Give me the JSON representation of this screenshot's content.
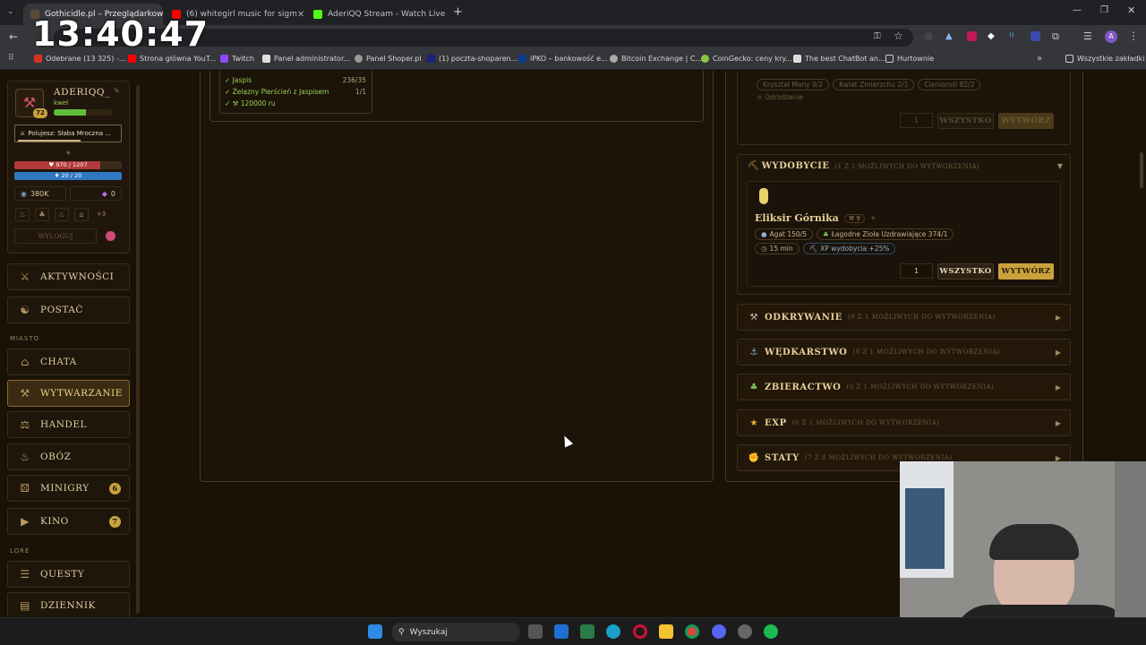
{
  "clock": "13:40:47",
  "browser": {
    "tabs": [
      {
        "title": "Gothicidle.pl – Przeglądarkow",
        "color": "#5a4a3a"
      },
      {
        "title": "(6) whitegirl music for sigm",
        "color": "#ff0000"
      },
      {
        "title": "AderiQQ Stream - Watch Live o",
        "color": "#53fc18"
      }
    ],
    "bookmarks": [
      {
        "label": "Odebrane (13 325) -...",
        "color": "#d93025"
      },
      {
        "label": "Strona główna YouT...",
        "color": "#ff0000"
      },
      {
        "label": "Twitch",
        "color": "#9146ff"
      },
      {
        "label": "Panel administrator...",
        "color": "#e0e0e0"
      },
      {
        "label": "Panel Shoper.pl",
        "color": "#999999"
      },
      {
        "label": "(1) poczta-shoparen...",
        "color": "#1a237e"
      },
      {
        "label": "iPKO – bankowość e...",
        "color": "#0b3d91"
      },
      {
        "label": "Bitcoin Exchange | C...",
        "color": "#aaaaaa"
      },
      {
        "label": "CoinGecko: ceny kry...",
        "color": "#8dc63f"
      },
      {
        "label": "The best ChatBot an...",
        "color": "#dddddd"
      },
      {
        "label": "Hurtownie",
        "color": "#888888"
      }
    ],
    "all_bookmarks": "Wszystkie zakładki"
  },
  "profile": {
    "name": "ADERIQQ_",
    "subtitle": "kwel",
    "level": "72",
    "xp_fraction": 0.55,
    "hunt": "Polujesz: Słaba Mroczna ...",
    "hp": "970 / 1207",
    "hp_fraction": 0.8,
    "mana": "20 / 20",
    "mana_fraction": 1.0,
    "gold": "380K",
    "gems": "0",
    "extra": "+3",
    "logout": "WYLOGUJ"
  },
  "nav": {
    "top": [
      {
        "label": "AKTYWNOŚCI",
        "icon": "crossed-swords-icon"
      },
      {
        "label": "POSTAĆ",
        "icon": "character-icon"
      }
    ],
    "section_city": "MIASTO",
    "city": [
      {
        "label": "CHATA",
        "icon": "hut-icon",
        "badge": ""
      },
      {
        "label": "WYTWARZANIE",
        "icon": "anvil-icon",
        "badge": "",
        "active": true
      },
      {
        "label": "HANDEL",
        "icon": "scales-icon",
        "badge": ""
      },
      {
        "label": "OBÓZ",
        "icon": "campfire-icon",
        "badge": ""
      },
      {
        "label": "MINIGRY",
        "icon": "dice-icon",
        "badge": "6"
      },
      {
        "label": "KINO",
        "icon": "film-icon",
        "badge": "7"
      }
    ],
    "section_lore": "LORE",
    "lore": [
      {
        "label": "QUESTY",
        "icon": "scroll-icon"
      },
      {
        "label": "DZIENNIK",
        "icon": "book-icon"
      }
    ]
  },
  "recipe_top": {
    "rows": [
      {
        "name": "Jaspis",
        "count": "236/35"
      },
      {
        "name": "Żelazny Pierścień z Jaspisem",
        "count": "1/1"
      },
      {
        "name": "120000 ru",
        "count": ""
      }
    ]
  },
  "right_top": {
    "pills": [
      "Kryształ Many 0/2",
      "Kwiat Zmierzchu 2/1",
      "Cieniorośl 82/2"
    ],
    "pill2": "Odrodzenie",
    "qty": "1",
    "all": "WSZYSTKO",
    "make": "WYTWÓRZ"
  },
  "mining": {
    "title": "WYDOBYCIE",
    "subtitle": "(1 Z 1 MOŻLIWYCH DO WYTWORZENIA)",
    "item": {
      "name": "Eliksir Górnika",
      "level": "9",
      "ingredients": [
        "Agat 150/5",
        "Łagodne Zioła Uzdrawiające 374/1"
      ],
      "time": "15 min",
      "bonus": "XP wydobycia +25%",
      "qty": "1",
      "all": "WSZYSTKO",
      "make": "WYTWÓRZ"
    }
  },
  "categories": [
    {
      "name": "ODKRYWANIE",
      "sub": "(0 Z 1 MOŻLIWYCH DO WYTWORZENIA)",
      "icon": "dig-icon",
      "color": "#cfc2a8"
    },
    {
      "name": "WĘDKARSTWO",
      "sub": "(0 Z 1 MOŻLIWYCH DO WYTWORZENIA)",
      "icon": "fishing-icon",
      "color": "#8fb0d0"
    },
    {
      "name": "ZBIERACTWO",
      "sub": "(0 Z 1 MOŻLIWYCH DO WYTWORZENIA)",
      "icon": "herb-icon",
      "color": "#7ec45a"
    },
    {
      "name": "EXP",
      "sub": "(0 Z 1 MOŻLIWYCH DO WYTWORZENIA)",
      "icon": "star-icon",
      "color": "#e8b53a"
    },
    {
      "name": "STATY",
      "sub": "(7 Z 8 MOŻLIWYCH DO WYTWORZENIA)",
      "icon": "muscle-icon",
      "color": "#e8b53a"
    }
  ],
  "taskbar": {
    "search": "Wyszukaj"
  }
}
